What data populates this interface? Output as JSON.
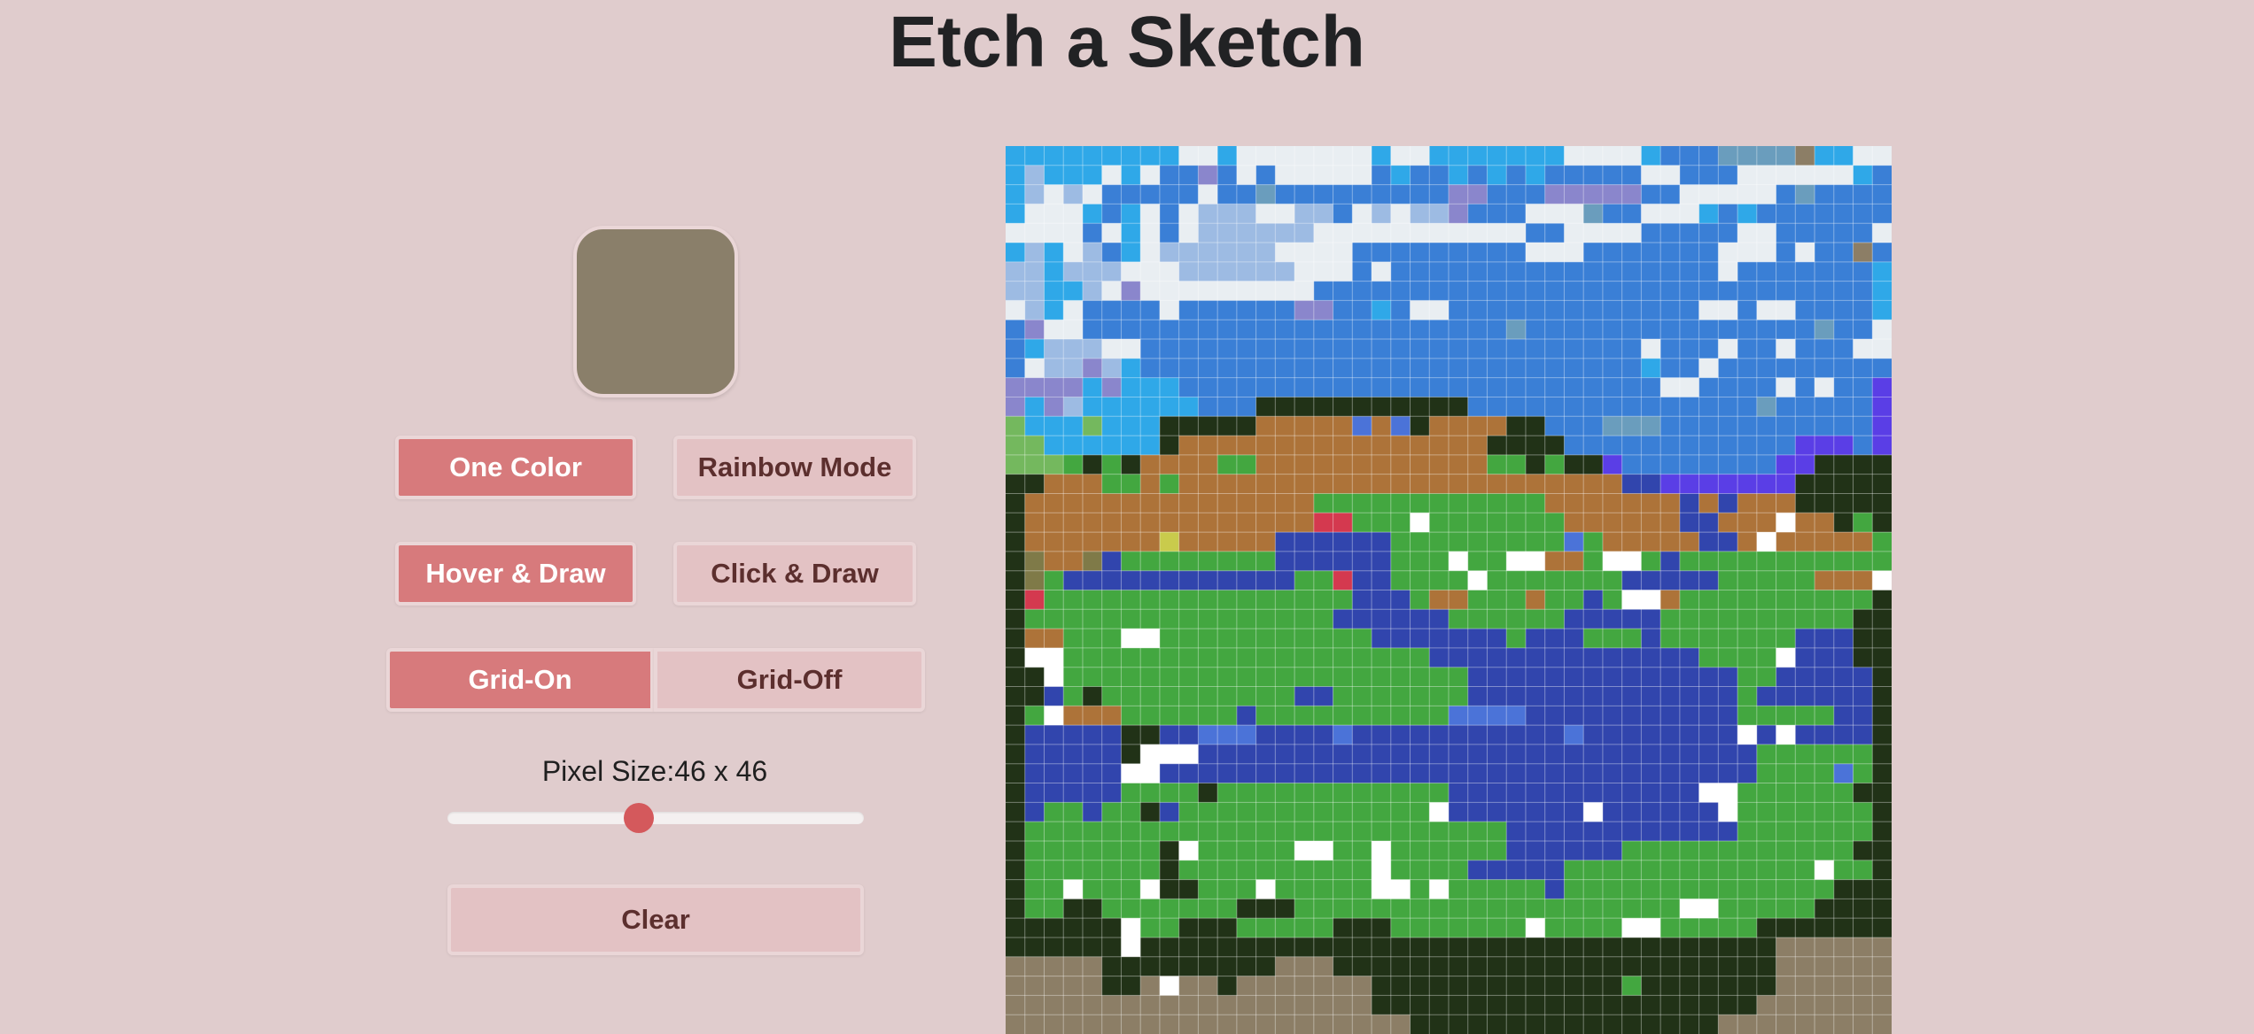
{
  "title": "Etch a Sketch",
  "current_color": "#8a7f6a",
  "mode_buttons": {
    "one_color": "One Color",
    "rainbow": "Rainbow Mode"
  },
  "draw_buttons": {
    "hover": "Hover & Draw",
    "click": "Click & Draw"
  },
  "grid_toggle": {
    "on": "Grid-On",
    "off": "Grid-Off"
  },
  "pixel_size": {
    "label": "Pixel Size:46 x 46",
    "value": 46,
    "min": 1,
    "max": 100
  },
  "clear_label": "Clear",
  "active_state": {
    "mode": "one_color",
    "draw": "hover",
    "grid": "on"
  },
  "colors": {
    "accent": "#d77a7c",
    "accent_inactive": "#e3c2c4",
    "background": "#e0cccd",
    "slider_thumb": "#d4595c"
  },
  "canvas": {
    "grid_size": 46,
    "grid_on": true,
    "palette": {
      "b": "#3a7fd6",
      "c": "#2fa8e8",
      "w": "#e9eef2",
      "W": "#ffffff",
      "l": "#9dbbe3",
      "p": "#8a86cc",
      "t": "#6a9dbd",
      "v": "#5a3ee6",
      "k": "#213217",
      "o": "#ad7339",
      "g": "#43a740",
      "G": "#74b85e",
      "n": "#3145ad",
      "m": "#4b73d8",
      "r": "#d4394f",
      "y": "#c9cb4c",
      "d": "#8c7e66",
      "O": "#7f7a48"
    },
    "rows": [
      "cccccccccwwcwwwwwwwcwwcccccccwwwwcbbbttttdccww",
      "clcccwcwbbpbwbwwwwwbcbbcbcbcbbbbbwwbbbwwwwwwcb",
      "clwlwbbbbbwbbtbbbbbbbbbppbbbpppppbbwwwwwbtbbbb",
      "cwwwcbcwbwlllwwllbwlwllpbbbwwwtbbwwwcbcbbbbbbb",
      "wwwwbwcwbwllllllwwwwwwwwwwwbbwwwwbbbbbwwbbbbbw",
      "clcwlbcwllllllwwwwbbbbbbbbbwwwbbbbbbbwwwbwbbdb",
      "llclllwwwllllllwwwbwbbbbbbbbbbbbbbbbbwbbbbbbbc",
      "llcclwpwwwwwwwwwbbbbbbbbbbbbbbbbbbbbbbbbbbbbbc",
      "wlcwbbbbwbbbbbbppbbcbwwbbbbbbbbbbbbbwwbwwbbbbc",
      "bpwwbbbbbbbbbbbbbbbbbbbbbbtbbbbbbbbbbbbbbbtbbw",
      "bclllwwbbbbbbbbbbbbbbbbbbbbbbbbbbwbbbwbbwbbbww",
      "bwllplcbbbbbbbbbbbbbbbbbbbbbbbbbbcbbwbbbbbbbbb",
      "ppppcpcccbbbbbbbbbbbbbbbbbbbbbbbbbwwbbbbwbwbbv",
      "pcplccccccbbbkkkkkkkkkkkbbbbbbbbbbbbbbbtbbbbbv",
      "GcccGccckkkkkooooomomkooookkbbbtttbbbbbbbbbbbv",
      "GGcccccckooooooooooooooookkkkbbbbbbbbbbbbvvvbv",
      "GGGgkgkooooggooooooooooooggkgkkvbbbbbbbbvvkkkk",
      "kkoooggogooooooooooooooooooooooonnvvvvvvvkkkkk",
      "koooooooooooooooggggggggggggooooooononoookkkkkk",
      "kooooooooooooooorrgggWgggggggoooooonnoooWookgkk",
      "koooooooyooooonnnnnngggggggggmgooooonnoWoooooggk",
      "kOooOnggggggggnnnnnngggWggWWoogWWgngggggggggggk",
      "kOgnnnnnnnnnnnnggrnnggggWgggggggnnnnngggggoooWk",
      "krggggggggggggggggnnngoogggoggngWWoggggggggggk",
      "kggggggggggggggggnnnnnnggggggnnnnnggggggggggkk",
      "koogggWWgggggggggggnnnnnnngnnngggngggggggnnnkk",
      "kWWgggggggggggggggggggnnnnnnnnnnnnnnggggWnnnkk",
      "kkWgggggggggggggggggggggnnnnnnnnnnnnnnggnnnnnk",
      "kkngkggggggggggnngggggggnnnnnnnnnnnnnngnnnnnnk",
      "kgWoooggggggnggggggggggmmmmnnnnnnnnnnngggggnnk",
      "knnnnnkknnmmmnnnnmnnnnnnnnnnnmnnnnnnnnWnWnnnnk",
      "knnnnnkWWWnnnnnnnnnnnnnnnnnnnnnnnnnnnnnggggggk",
      "knnnnnWWnnnnnnnnnnnnnnnnnnnnnnnnnnnnnnnggggmgk",
      "knnnnnggggkggggggggggggnnnnnnnnnnnnnWWggggggkk",
      "knggnggkngggggggggggggWnnnnnnnWnnnnnnWgggggggk",
      "kgggggggggggggggggggggggggnnnnnnnnnnnngggggggk",
      "kgggggggkWgggggWWggWggggggnnnnnnggggggggggggkk",
      "kgggggggkggggggggggWggggnnnnngggggggggggggWggk",
      "kggWgggWkkgggWgggggWWgWgggggnggggggggggggggkkk",
      "kggkkgggggggkkkggggggggggggggggggggWWgggggkkk",
      "kkkkkkWggkkkgggggkkkgggggggWggggWWgggggkkkkkkk",
      "kkkkkkWkkkkkkkkkkkkkkkkkkkkkkkkkkkkkkkkkddddddd",
      "dddddkkkkkkkkkdddkkkkkkkkkkkkkkkkkkkkkkkddddddd",
      "dddddkkdWddkdddddddkkkkkkkkkkkkkgkkkkkkkdddddddd",
      "dddddddddddddddddddkkkkkkkkkkkkkkkkkkkkddddddddd",
      "dddddddddddddddddddddkkkkkkkkkkkkkkkkdddddddddd"
    ]
  }
}
